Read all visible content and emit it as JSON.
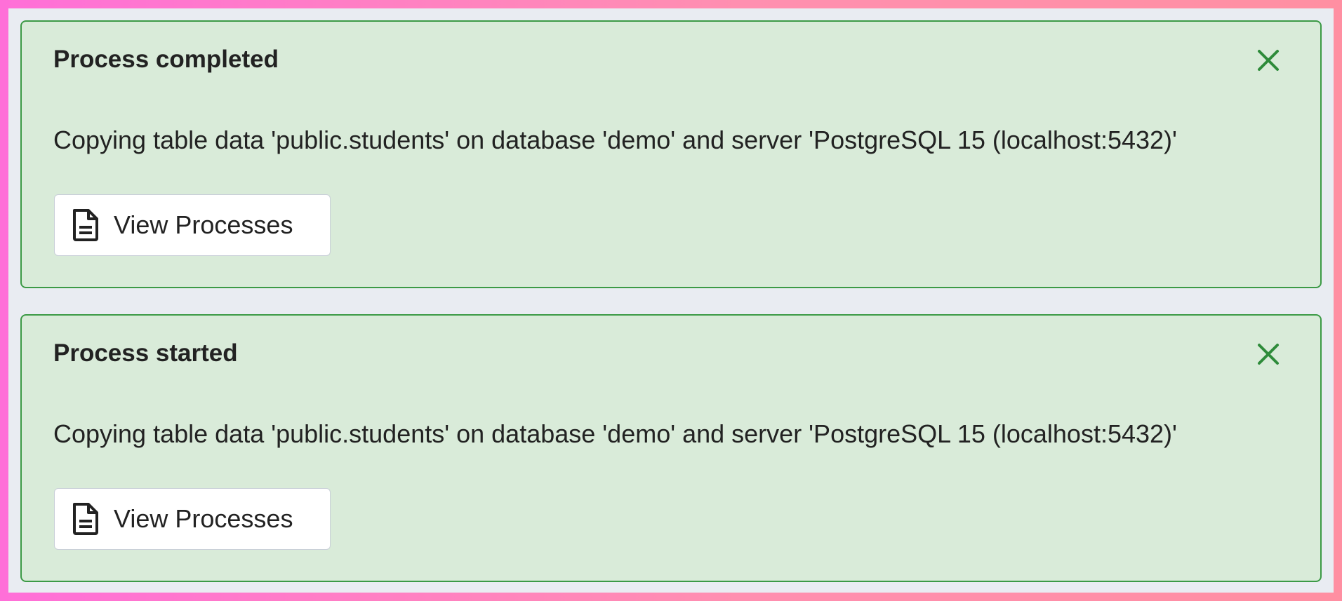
{
  "notifications": [
    {
      "title": "Process completed",
      "message": "Copying table data 'public.students' on database 'demo' and server 'PostgreSQL 15 (localhost:5432)'",
      "button_label": "View Processes",
      "close_icon": "close-icon",
      "button_icon": "document-icon"
    },
    {
      "title": "Process started",
      "message": "Copying table data 'public.students' on database 'demo' and server 'PostgreSQL 15 (localhost:5432)'",
      "button_label": "View Processes",
      "close_icon": "close-icon",
      "button_icon": "document-icon"
    }
  ],
  "colors": {
    "notification_background": "#d9ebd9",
    "notification_border": "#3c9a46",
    "close_icon": "#2e8b3a",
    "panel_background": "#e9ecf2"
  }
}
